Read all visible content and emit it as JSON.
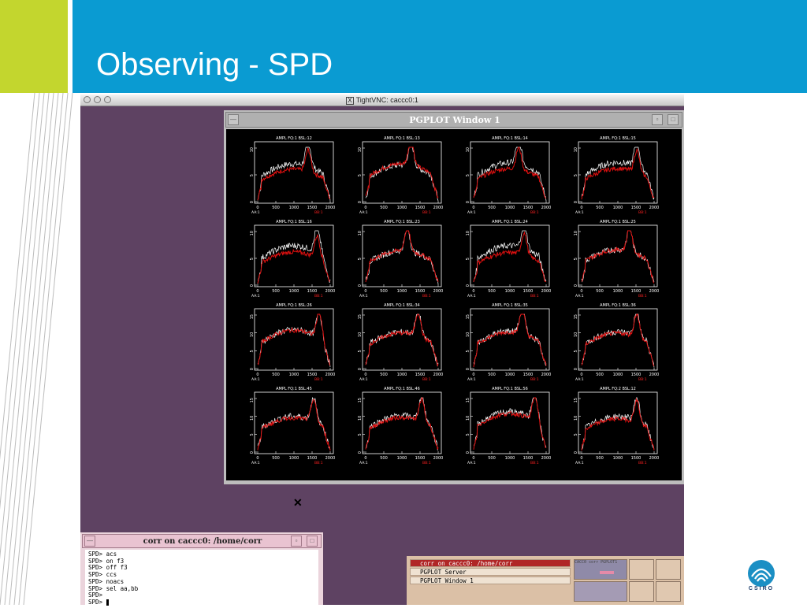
{
  "slide": {
    "title": "Observing - SPD",
    "logo_text": "CSIRO",
    "colors": {
      "header": "#0a9bd2",
      "accent": "#c3d62e"
    }
  },
  "vnc": {
    "title": "TightVNC: caccc0:1",
    "title_icon": "X"
  },
  "pgplot": {
    "title": "PGPLOT Window 1",
    "footer_left": "AA:1",
    "footer_right": "BB:1",
    "x_ticks": [
      "0",
      "500",
      "1000",
      "1500",
      "2000"
    ],
    "y_ticks": [
      "0",
      "5",
      "10"
    ],
    "y_ticks_alt": [
      "0",
      "5",
      "10",
      "15"
    ],
    "panels": [
      {
        "title": "AMPL FQ:1 BSL:12"
      },
      {
        "title": "AMPL FQ:1 BSL:13"
      },
      {
        "title": "AMPL FQ:1 BSL:14"
      },
      {
        "title": "AMPL FQ:1 BSL:15"
      },
      {
        "title": "AMPL FQ:1 BSL:16"
      },
      {
        "title": "AMPL FQ:1 BSL:23"
      },
      {
        "title": "AMPL FQ:1 BSL:24"
      },
      {
        "title": "AMPL FQ:1 BSL:25"
      },
      {
        "title": "AMPL FQ:1 BSL:26"
      },
      {
        "title": "AMPL FQ:1 BSL:34"
      },
      {
        "title": "AMPL FQ:1 BSL:35"
      },
      {
        "title": "AMPL FQ:1 BSL:36"
      },
      {
        "title": "AMPL FQ:1 BSL:45"
      },
      {
        "title": "AMPL FQ:1 BSL:46"
      },
      {
        "title": "AMPL FQ:1 BSL:56"
      },
      {
        "title": "AMPL FQ:2 BSL:12"
      }
    ]
  },
  "terminal": {
    "title": "corr on caccc0: /home/corr",
    "lines": [
      "SPD> acs",
      "SPD> on f3",
      "SPD> off f3",
      "SPD> ccs",
      "SPD> noacs",
      "SPD> sel aa,bb",
      "SPD>",
      "SPD>"
    ]
  },
  "tasks": {
    "items": [
      "corr on caccc0: /home/corr",
      "PGPLOT Server",
      "PGPLOT Window 1"
    ],
    "pager_labels": [
      "CACC0",
      "corr",
      "PGPLOT1"
    ]
  }
}
